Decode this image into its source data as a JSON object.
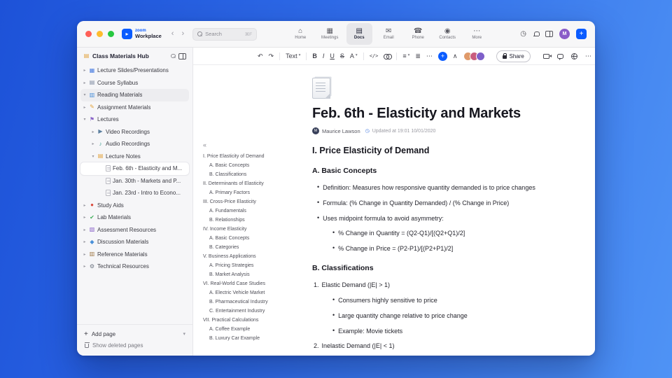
{
  "colors": {
    "accent": "#0b5cff",
    "window_chrome": "#f7f7f8",
    "sidebar_bg": "#f6f6f8"
  },
  "titlebar": {
    "brand_zoom": "zoom",
    "brand_workplace": "Workplace",
    "search_placeholder": "Search",
    "search_shortcut": "⌘F",
    "avatar_initial": "M",
    "tabs": [
      {
        "label": "Home",
        "glyph": "⌂",
        "icon": "home-icon",
        "active": false
      },
      {
        "label": "Meetings",
        "glyph": "▦",
        "icon": "calendar-icon",
        "active": false
      },
      {
        "label": "Docs",
        "glyph": "▤",
        "icon": "docs-icon",
        "active": true
      },
      {
        "label": "Email",
        "glyph": "✉",
        "icon": "email-icon",
        "active": false
      },
      {
        "label": "Phone",
        "glyph": "☎",
        "icon": "phone-icon",
        "active": false
      },
      {
        "label": "Contacts",
        "glyph": "◉",
        "icon": "contacts-icon",
        "active": false
      },
      {
        "label": "More",
        "glyph": "⋯",
        "icon": "more-icon",
        "active": false
      }
    ]
  },
  "sidebar": {
    "title": "Class Materials Hub",
    "add_page_label": "Add page",
    "show_deleted_label": "Show deleted pages",
    "tree": [
      {
        "label": "Lecture Slides/Presentations",
        "level": 0,
        "glyph": "▦",
        "color": "#4a7de0",
        "icon": "presentation-icon",
        "chevron": "right"
      },
      {
        "label": "Course Syllabus",
        "level": 0,
        "glyph": "▤",
        "color": "#7d8aa0",
        "icon": "clipboard-icon",
        "chevron": "right"
      },
      {
        "label": "Reading Materials",
        "level": 0,
        "glyph": "▥",
        "color": "#4a90d9",
        "icon": "open-book-icon",
        "chevron": "down",
        "highlighted": true
      },
      {
        "label": "Assignment Materials",
        "level": 0,
        "glyph": "✎",
        "color": "#e2a23b",
        "icon": "pencil-icon",
        "chevron": "right"
      },
      {
        "label": "Lectures",
        "level": 0,
        "glyph": "⚑",
        "color": "#8a64c8",
        "icon": "flag-icon",
        "chevron": "down"
      },
      {
        "label": "Video Recordings",
        "level": 1,
        "glyph": "▶",
        "color": "#5b7f9e",
        "icon": "video-icon",
        "chevron": "right"
      },
      {
        "label": "Audio Recordings",
        "level": 1,
        "glyph": "♪",
        "color": "#3f9e8f",
        "icon": "headphones-icon",
        "chevron": "right"
      },
      {
        "label": "Lecture Notes",
        "level": 1,
        "glyph": "▤",
        "color": "#e2a23b",
        "icon": "notebook-icon",
        "chevron": "down"
      },
      {
        "label": "Feb. 6th - Elasticity and M...",
        "level": 2,
        "kind": "doc",
        "icon": "page-icon",
        "selected": true
      },
      {
        "label": "Jan. 30th - Markets and P...",
        "level": 2,
        "kind": "doc",
        "icon": "page-icon"
      },
      {
        "label": "Jan. 23rd - Intro to Econo...",
        "level": 2,
        "kind": "doc",
        "icon": "page-icon"
      },
      {
        "label": "Study Aids",
        "level": 0,
        "glyph": "●",
        "color": "#d9483b",
        "icon": "apple-icon",
        "chevron": "right"
      },
      {
        "label": "Lab Materials",
        "level": 0,
        "glyph": "✔",
        "color": "#3fae5a",
        "icon": "check-icon",
        "chevron": "right"
      },
      {
        "label": "Assessment Resources",
        "level": 0,
        "glyph": "▧",
        "color": "#8a64c8",
        "icon": "assessment-icon",
        "chevron": "right"
      },
      {
        "label": "Discussion Materials",
        "level": 0,
        "glyph": "◆",
        "color": "#4a90d9",
        "icon": "discussion-icon",
        "chevron": "right"
      },
      {
        "label": "Reference Materials",
        "level": 0,
        "glyph": "▥",
        "color": "#a07a4a",
        "icon": "books-icon",
        "chevron": "right"
      },
      {
        "label": "Technical Resources",
        "level": 0,
        "glyph": "⚙",
        "color": "#6e7683",
        "icon": "gear-icon",
        "chevron": "right"
      }
    ]
  },
  "toolbar": {
    "undo": "↶",
    "redo": "↷",
    "text_style_label": "Text",
    "bold": "B",
    "italic": "I",
    "underline": "U",
    "strike": "S",
    "color_label": "A",
    "code_label": "</>",
    "align": "≡",
    "list": "≣",
    "more": "⋯",
    "collapse": "∧",
    "share_label": "Share",
    "avatars": [
      {
        "bg": "#e09a6a"
      },
      {
        "bg": "#c95c7e"
      },
      {
        "bg": "#7e5fc9"
      }
    ]
  },
  "doc": {
    "title": "Feb. 6th - Elasticity and Markets",
    "author": "Maurice Lawson",
    "author_initial": "M",
    "updated": "Updated at 19:01 10/01/2020",
    "toc_collapse": "«",
    "toc": [
      {
        "label": "I. Price Elasticity of Demand",
        "level": 0
      },
      {
        "label": "A. Basic Concepts",
        "level": 1
      },
      {
        "label": "B. Classifications",
        "level": 1
      },
      {
        "label": "II. Determinants of Elasticity",
        "level": 0
      },
      {
        "label": "A. Primary Factors",
        "level": 1
      },
      {
        "label": "III. Cross-Price Elasticity",
        "level": 0
      },
      {
        "label": "A. Fundamentals",
        "level": 1
      },
      {
        "label": "B. Relationships",
        "level": 1
      },
      {
        "label": "IV. Income Elasticity",
        "level": 0
      },
      {
        "label": "A. Basic Concepts",
        "level": 1
      },
      {
        "label": "B. Categories",
        "level": 1
      },
      {
        "label": "V. Business Applications",
        "level": 0
      },
      {
        "label": "A. Pricing Strategies",
        "level": 1
      },
      {
        "label": "B. Market Analysis",
        "level": 1
      },
      {
        "label": "VI. Real-World Case Studies",
        "level": 0
      },
      {
        "label": "A. Electric Vehicle Market",
        "level": 1
      },
      {
        "label": "B. Pharmaceutical Industry",
        "level": 1
      },
      {
        "label": "C. Entertainment Industry",
        "level": 1
      },
      {
        "label": "VII. Practical Calculations",
        "level": 0
      },
      {
        "label": "A. Coffee Example",
        "level": 1
      },
      {
        "label": "B. Luxury Car Example",
        "level": 1
      }
    ],
    "blocks": [
      {
        "type": "h1",
        "text": "I. Price Elasticity of Demand"
      },
      {
        "type": "h2",
        "text": "A. Basic Concepts"
      },
      {
        "type": "bullet",
        "level": 0,
        "text": "Definition: Measures how responsive quantity demanded is to price changes"
      },
      {
        "type": "bullet",
        "level": 0,
        "text": "Formula: (% Change in Quantity Demanded) / (% Change in Price)"
      },
      {
        "type": "bullet",
        "level": 0,
        "text": "Uses midpoint formula to avoid asymmetry:"
      },
      {
        "type": "bullet",
        "level": 1,
        "text": "% Change in Quantity = (Q2-Q1)/[(Q2+Q1)/2]"
      },
      {
        "type": "bullet",
        "level": 1,
        "text": "% Change in Price = (P2-P1)/[(P2+P1)/2]"
      },
      {
        "type": "h2",
        "text": "B. Classifications"
      },
      {
        "type": "number",
        "num": "1.",
        "text": "Elastic Demand (|E| > 1)"
      },
      {
        "type": "bullet",
        "level": 1,
        "text": "Consumers highly sensitive to price"
      },
      {
        "type": "bullet",
        "level": 1,
        "text": "Large quantity change relative to price change"
      },
      {
        "type": "bullet",
        "level": 1,
        "text": "Example: Movie tickets"
      },
      {
        "type": "number",
        "num": "2.",
        "text": "Inelastic Demand (|E| < 1)"
      }
    ]
  }
}
